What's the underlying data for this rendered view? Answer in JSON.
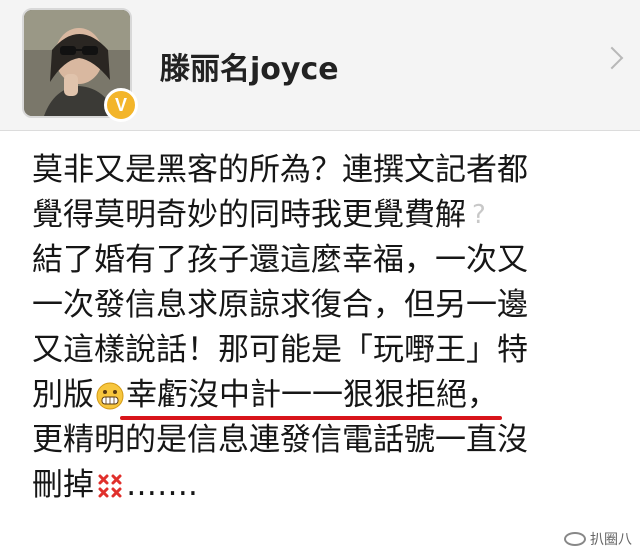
{
  "header": {
    "username": "滕丽名joyce",
    "verified_badge": "V",
    "avatar_icon": "profile-avatar",
    "chevron_icon": "chevron-right-icon"
  },
  "post": {
    "line1": "莫非又是黑客的所為？連撰文記者都",
    "line2": "覺得莫明奇妙的同時我更覺費解",
    "line2_icon": "question-mark-icon",
    "line3": "結了婚有了孩子還這麼幸福，一次又",
    "line4": "一次發信息求原諒求復合，但另一邊",
    "line5": "又這樣說話！那可能是「玩嘢王」特",
    "line6_pre": "別版",
    "line6_emoji": "grimace-emoji-icon",
    "line6_highlight": "幸虧沒中計一一狠狠拒絕，",
    "line7": "更精明的是信息連發信電話號一直沒",
    "line8_pre": "刪掉",
    "line8_emoji": "angry-emoji-icon",
    "line8_post": "……."
  },
  "watermark": {
    "text": "扒圈八",
    "icon": "wechat-logo-icon"
  },
  "colors": {
    "underline": "#d8141a",
    "badge": "#f3b52a",
    "header_bg": "#f4f4f4"
  }
}
